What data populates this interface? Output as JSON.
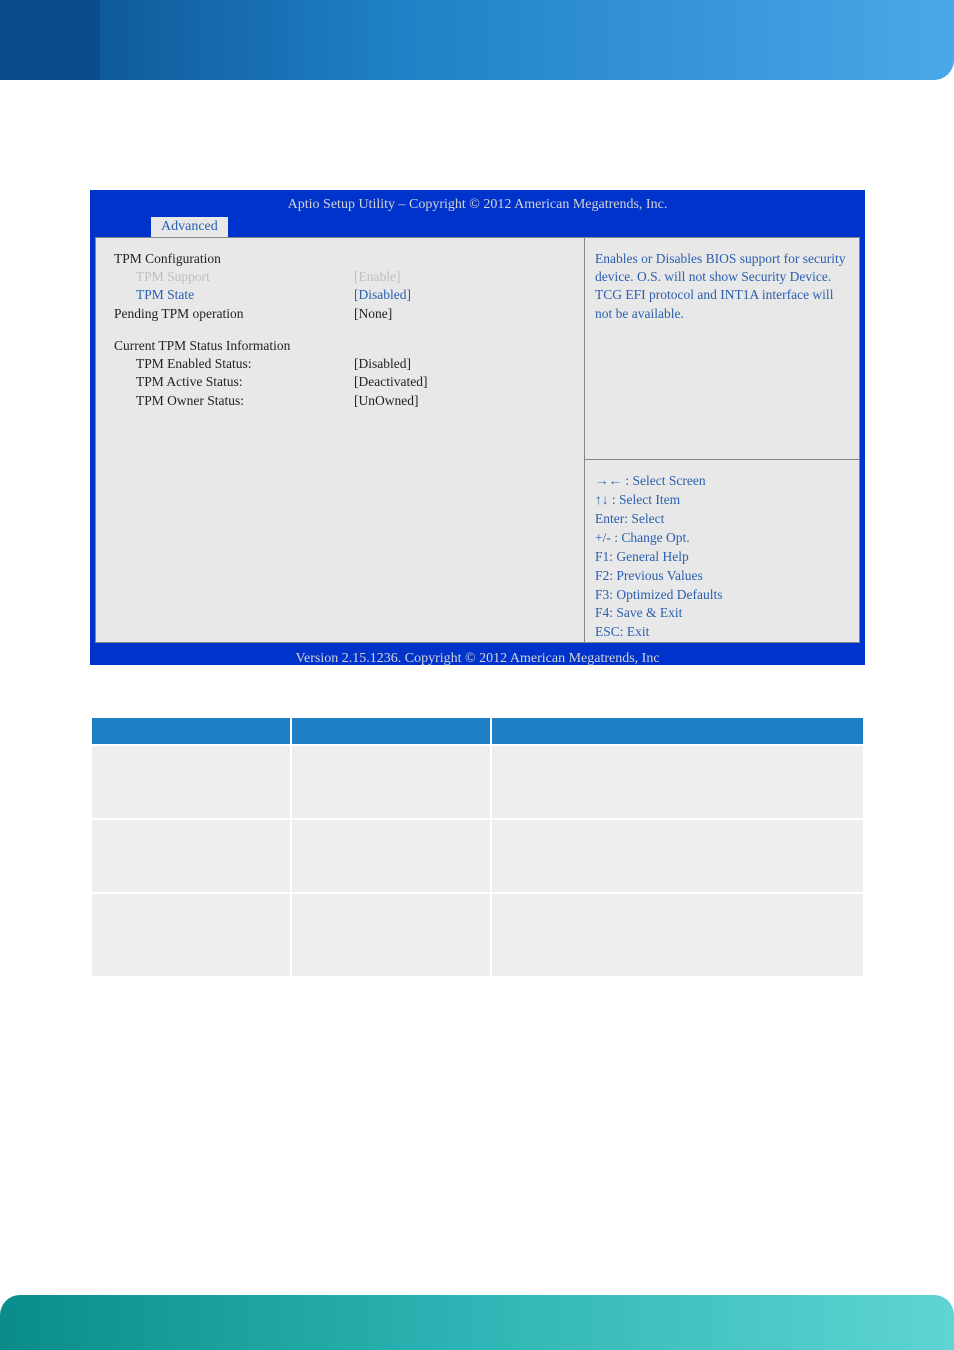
{
  "bios": {
    "title": "Aptio Setup Utility  –  Copyright © 2012 American Megatrends, Inc.",
    "tab": "Advanced",
    "footer": "Version 2.15.1236. Copyright © 2012 American Megatrends, Inc",
    "section1_title": "TPM Configuration",
    "items": [
      {
        "label": "TPM Support",
        "value": "[Enable]",
        "style": "grey"
      },
      {
        "label": "TPM State",
        "value": "[Disabled]",
        "style": "blue"
      },
      {
        "label": "Pending TPM operation",
        "value": "[None]",
        "style": "black"
      }
    ],
    "section2_title": "Current TPM Status Information",
    "status": [
      {
        "label": "TPM Enabled Status:",
        "value": "[Disabled]"
      },
      {
        "label": "TPM Active Status:",
        "value": "[Deactivated]"
      },
      {
        "label": "TPM Owner Status:",
        "value": "[UnOwned]"
      }
    ],
    "help": "Enables or Disables BIOS support for security device. O.S. will not show Security Device. TCG EFI protocol and INT1A interface will not be available.",
    "nav": {
      "n1": "→← : Select Screen",
      "n2": "↑↓ : Select Item",
      "n3": "Enter: Select",
      "n4": "+/- : Change Opt.",
      "n5": "F1: General Help",
      "n6": "F2: Previous Values",
      "n7": "F3: Optimized Defaults",
      "n8": "F4: Save & Exit",
      "n9": "ESC: Exit"
    }
  },
  "table": {
    "headers": [
      "",
      "",
      ""
    ],
    "rows": [
      [
        "",
        "",
        ""
      ],
      [
        "",
        "",
        ""
      ],
      [
        "",
        "",
        ""
      ]
    ]
  }
}
